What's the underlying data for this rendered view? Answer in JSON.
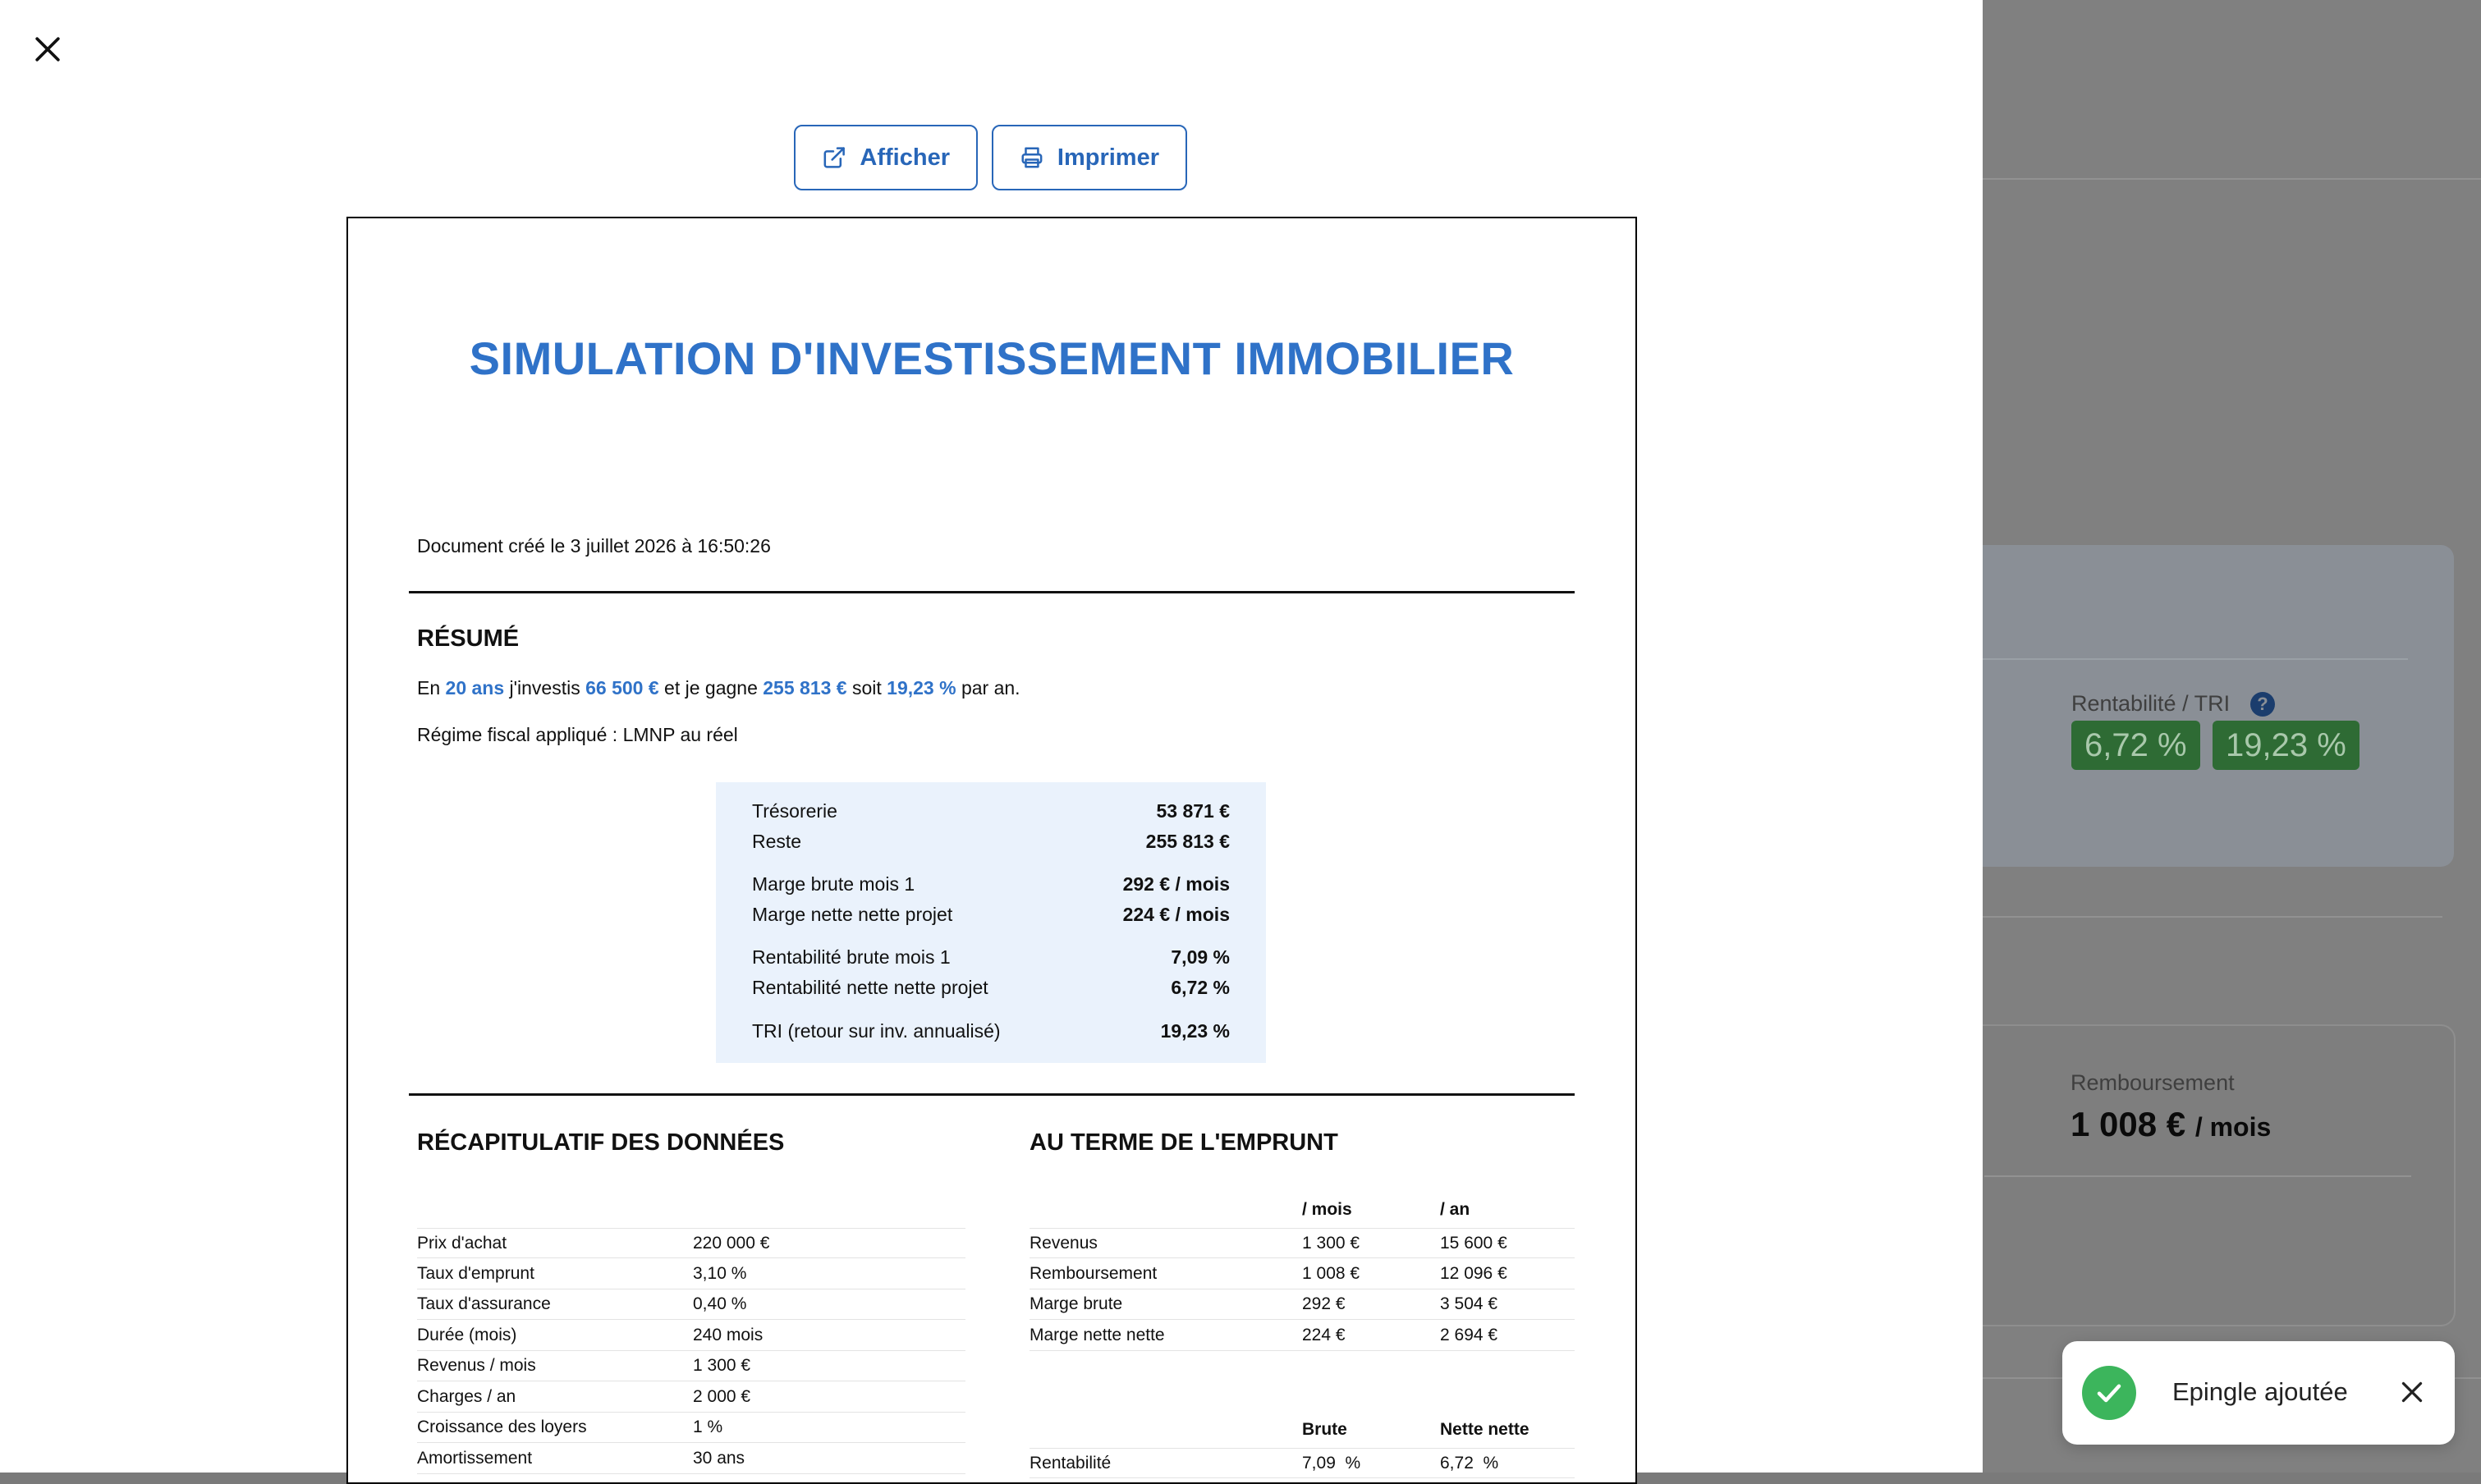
{
  "toolbar": {
    "view_label": "Afficher",
    "print_label": "Imprimer"
  },
  "document": {
    "title": "SIMULATION D'INVESTISSEMENT IMMOBILIER",
    "created": "Document créé le 3 juillet 2026 à 16:50:26",
    "summary": {
      "heading": "RÉSUMÉ",
      "sentence": {
        "p1": "En",
        "years": "20 ans",
        "p2": "j'investis",
        "invest": "66 500 €",
        "p3": "et je gagne",
        "gain": "255 813 €",
        "p4": "soit",
        "rate": "19,23 %",
        "p5": "par an."
      },
      "regime": "Régime fiscal appliqué : LMNP au réel",
      "kpis": [
        {
          "label": "Trésorerie",
          "value": "53 871 €"
        },
        {
          "label": "Reste",
          "value": "255 813 €"
        },
        {
          "label": "Marge brute mois 1",
          "value": "292 € / mois"
        },
        {
          "label": "Marge nette nette projet",
          "value": "224 € / mois"
        },
        {
          "label": "Rentabilité brute mois 1",
          "value": "7,09 %"
        },
        {
          "label": "Rentabilité nette nette projet",
          "value": "6,72 %"
        },
        {
          "label": "TRI (retour sur inv. annualisé)",
          "value": "19,23 %"
        }
      ]
    },
    "recap": {
      "heading": "RÉCAPITULATIF DES DONNÉES",
      "rows": [
        {
          "label": "Prix d'achat",
          "value": "220 000 €"
        },
        {
          "label": "Taux d'emprunt",
          "value": "3,10 %"
        },
        {
          "label": "Taux d'assurance",
          "value": "0,40 %"
        },
        {
          "label": "Durée (mois)",
          "value": "240 mois"
        },
        {
          "label": "Revenus / mois",
          "value": "1 300 €"
        },
        {
          "label": "Charges / an",
          "value": "2 000 €"
        },
        {
          "label": "Croissance des loyers",
          "value": "1 %"
        },
        {
          "label": "Amortissement",
          "value": "30 ans"
        }
      ]
    },
    "term": {
      "heading": "AU TERME DE L'EMPRUNT",
      "col_month": "/ mois",
      "col_year": "/ an",
      "rows": [
        {
          "label": "Revenus",
          "month": "1 300 €",
          "year": "15 600 €"
        },
        {
          "label": "Remboursement",
          "month": "1 008 €",
          "year": "12 096 €"
        },
        {
          "label": "Marge brute",
          "month": "292 €",
          "year": "3 504 €"
        },
        {
          "label": "Marge nette nette",
          "month": "224 €",
          "year": "2 694 €"
        }
      ],
      "col_brute": "Brute",
      "col_nette": "Nette nette",
      "rentab_label": "Rentabilité",
      "rentab_brute": "7,09  %",
      "rentab_nette": "6,72  %"
    }
  },
  "background": {
    "rentab_label": "Rentabilité / TRI",
    "help": "?",
    "badge1": "6,72 %",
    "badge2": "19,23 %",
    "remb_label": "Remboursement",
    "remb_value": "1 008 €",
    "remb_unit": "/ mois"
  },
  "toast": {
    "message": "Epingle ajoutée"
  },
  "colors": {
    "accent": "#2f72c8",
    "button": "#2866b8",
    "success": "#3cb55c",
    "kpi_bg": "#eaf2fc"
  }
}
